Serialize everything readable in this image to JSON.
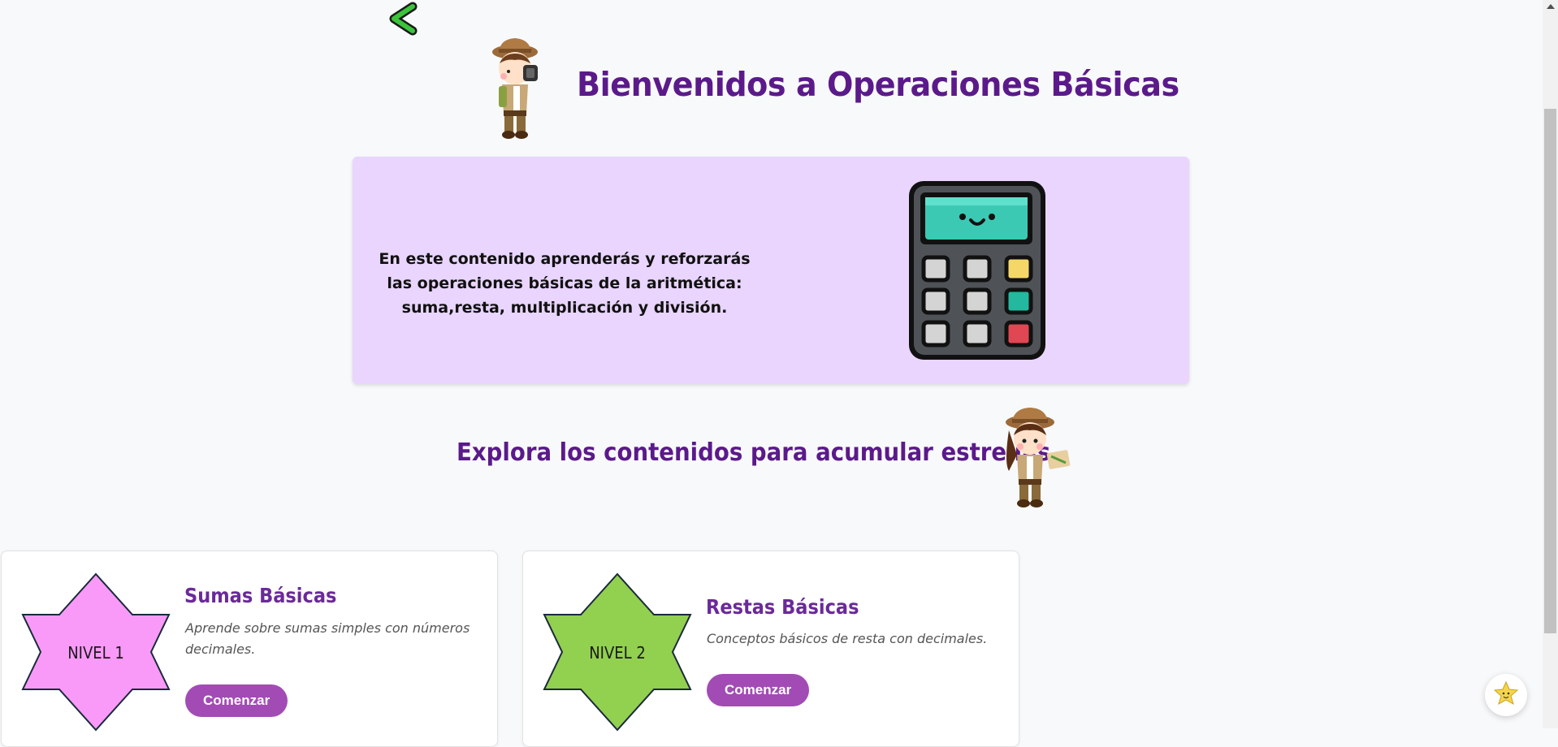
{
  "header": {
    "title": "Bienvenidos a Operaciones Básicas"
  },
  "intro": {
    "text": "En este contenido aprenderás y reforzarás las operaciones básicas de la aritmética: suma,resta, multiplicación y división."
  },
  "subtitle": "Explora los contenidos para acumular estrellas",
  "levels": [
    {
      "badge": "NIVEL 1",
      "title": "Sumas Básicas",
      "description": "Aprende sobre sumas simples con números decimales.",
      "button": "Comenzar",
      "color": "#f99af9"
    },
    {
      "badge": "NIVEL 2",
      "title": "Restas Básicas",
      "description": "Conceptos básicos de resta con decimales.",
      "button": "Comenzar",
      "color": "#92d050"
    }
  ],
  "icons": {
    "back": "chevron-left-icon",
    "fab": "star-icon",
    "calculator": "calculator-icon"
  },
  "colors": {
    "accent": "#5b1a8a",
    "button": "#a24bb5",
    "intro_bg": "#e9d5fd"
  }
}
